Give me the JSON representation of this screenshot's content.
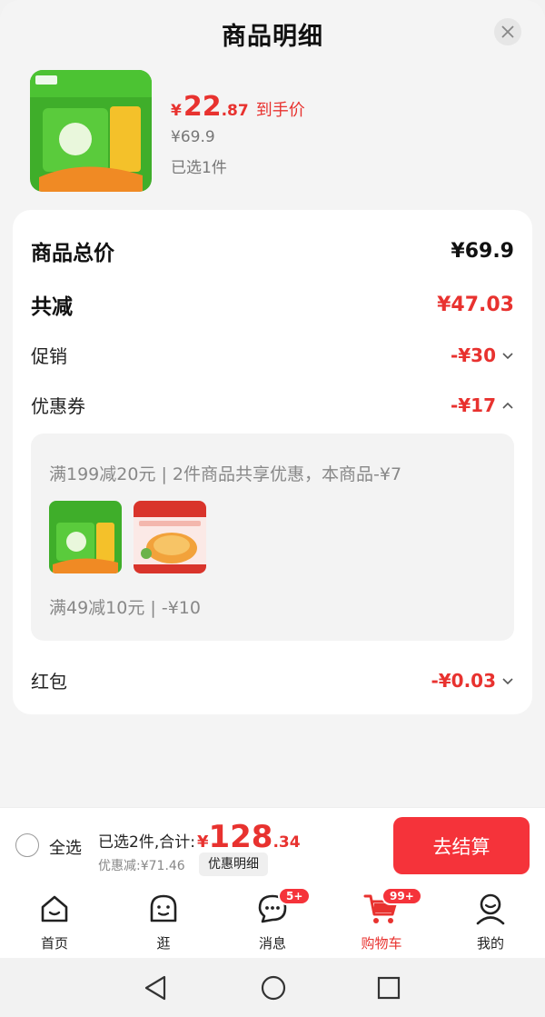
{
  "sheet": {
    "title": "商品明细",
    "product": {
      "price_yen": "¥",
      "price_int": "22",
      "price_dec": ".87",
      "price_tag": "到手价",
      "original_price": "¥69.9",
      "selected": "已选1件"
    }
  },
  "breakdown": {
    "total_label": "商品总价",
    "total_value": "¥69.9",
    "reduce_label": "共减",
    "reduce_value": "¥47.03",
    "promo_label": "促销",
    "promo_value": "-¥30",
    "coupon_label": "优惠券",
    "coupon_value": "-¥17",
    "coupon_detail_1": "满199减20元 | 2件商品共享优惠，本商品-¥7",
    "coupon_detail_2": "满49减10元 | -¥10",
    "redpacket_label": "红包",
    "redpacket_value": "-¥0.03"
  },
  "checkout": {
    "select_all": "全选",
    "summary_prefix": "已选2件,合计:",
    "total_yen": "¥",
    "total_int": "128",
    "total_dec": ".34",
    "discount": "优惠减:¥71.46",
    "detail_button": "优惠明细",
    "submit": "去结算"
  },
  "tabbar": {
    "items": [
      {
        "label": "首页",
        "icon": "home-icon"
      },
      {
        "label": "逛",
        "icon": "browse-icon"
      },
      {
        "label": "消息",
        "icon": "message-icon",
        "badge": "5+"
      },
      {
        "label": "购物车",
        "icon": "cart-icon",
        "badge": "99+"
      },
      {
        "label": "我的",
        "icon": "profile-icon"
      }
    ]
  },
  "colors": {
    "accent": "#e8322f",
    "button": "#f5333a",
    "product_green": "#3fae2a"
  }
}
